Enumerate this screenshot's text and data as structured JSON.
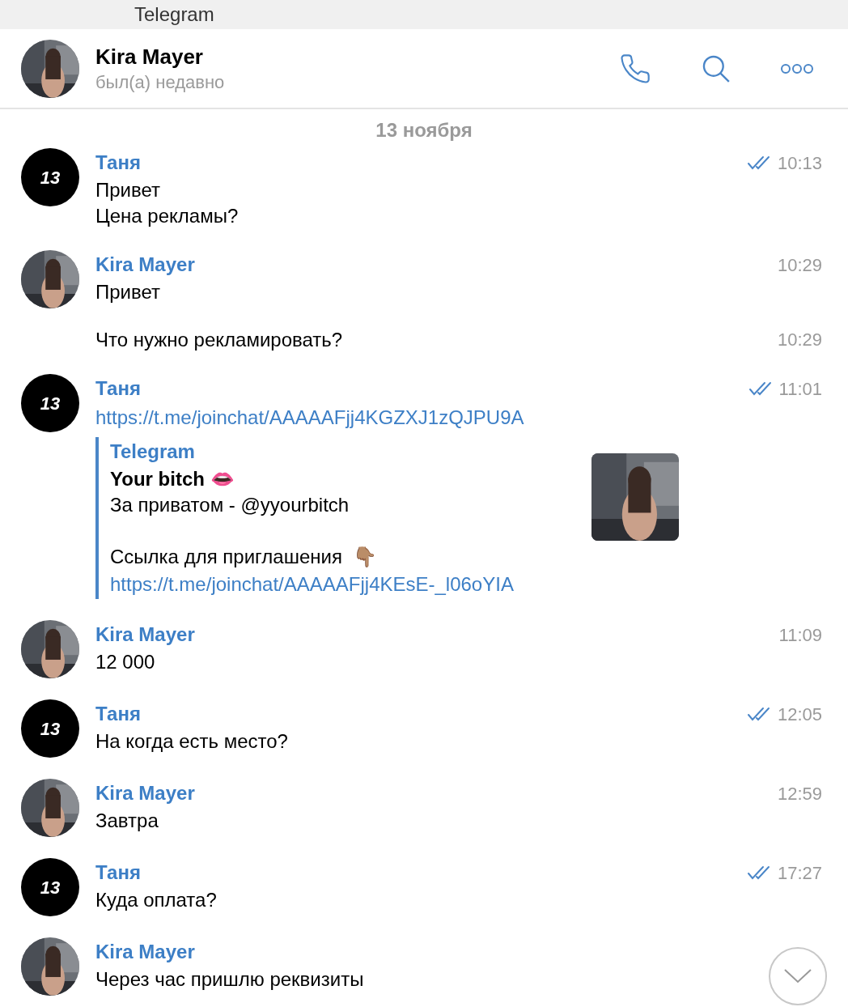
{
  "window": {
    "title": "Telegram"
  },
  "header": {
    "name": "Kira Mayer",
    "status": "был(а) недавно",
    "avatar": {
      "kind": "picture"
    }
  },
  "date": "13 ноября",
  "messages": [
    {
      "sender": "Таня",
      "avatar": {
        "kind": "badge",
        "text": "13"
      },
      "time": "10:13",
      "read": true,
      "body": [
        {
          "kind": "text",
          "text": "Привет"
        },
        {
          "kind": "text",
          "text": "Цена рекламы?"
        }
      ]
    },
    {
      "sender": "Kira Mayer",
      "avatar": {
        "kind": "picture"
      },
      "time": "10:29",
      "read": false,
      "body": [
        {
          "kind": "text",
          "text": "Привет"
        }
      ]
    },
    {
      "avatar": {
        "kind": "none"
      },
      "time": "10:29",
      "read": false,
      "body": [
        {
          "kind": "text",
          "text": "Что нужно рекламировать?"
        }
      ]
    },
    {
      "sender": "Таня",
      "avatar": {
        "kind": "badge",
        "text": "13"
      },
      "time": "11:01",
      "read": true,
      "body": [
        {
          "kind": "link",
          "text": "https://t.me/joinchat/AAAAAFjj4KGZXJ1zQJPU9A"
        },
        {
          "kind": "preview",
          "site": "Telegram",
          "title": "Your bitch 👄",
          "lines": [
            "За приватом - @yyourbitch"
          ],
          "invite": "Ссылка для приглашения  👇🏽",
          "link": "https://t.me/joinchat/AAAAAFjj4KEsE-_l06oYIA"
        }
      ]
    },
    {
      "sender": "Kira Mayer",
      "avatar": {
        "kind": "picture"
      },
      "time": "11:09",
      "read": false,
      "body": [
        {
          "kind": "text",
          "text": "12 000"
        }
      ]
    },
    {
      "sender": "Таня",
      "avatar": {
        "kind": "badge",
        "text": "13"
      },
      "time": "12:05",
      "read": true,
      "body": [
        {
          "kind": "text",
          "text": "На когда есть место?"
        }
      ]
    },
    {
      "sender": "Kira Mayer",
      "avatar": {
        "kind": "picture"
      },
      "time": "12:59",
      "read": false,
      "body": [
        {
          "kind": "text",
          "text": "Завтра"
        }
      ]
    },
    {
      "sender": "Таня",
      "avatar": {
        "kind": "badge",
        "text": "13"
      },
      "time": "17:27",
      "read": true,
      "body": [
        {
          "kind": "text",
          "text": "Куда оплата?"
        }
      ]
    },
    {
      "sender": "Kira Mayer",
      "avatar": {
        "kind": "picture"
      },
      "read": false,
      "body": [
        {
          "kind": "text",
          "text": "Через час пришлю реквизиты"
        }
      ]
    }
  ]
}
